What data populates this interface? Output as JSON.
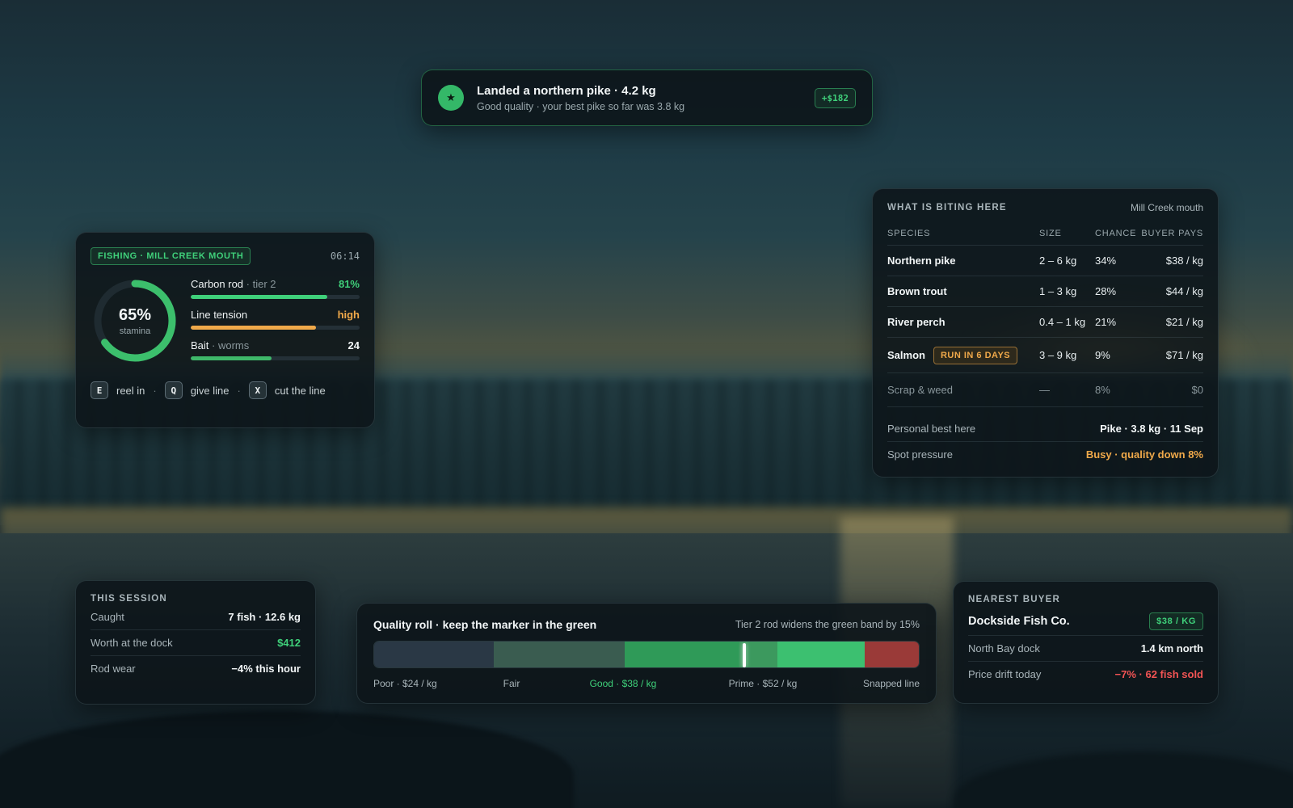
{
  "colors": {
    "accent_green": "#3fd07a",
    "warning_orange": "#f0a94a",
    "danger_red": "#f25454",
    "panel_bg": "#0c1419"
  },
  "toast": {
    "icon": "star-icon",
    "icon_glyph": "★",
    "title": "Landed a northern pike · 4.2 kg",
    "subtitle": "Good quality · your best pike so far was 3.8 kg",
    "reward": "+$182"
  },
  "fishing": {
    "tag": "FISHING · MILL CREEK MOUTH",
    "clock": "06:14",
    "stamina": {
      "percent_label": "65%",
      "label": "stamina",
      "value": 0.65
    },
    "stats": [
      {
        "label": "Carbon rod",
        "sub": " · tier 2",
        "value": "81%",
        "fill": 0.81,
        "color": "#3fd07a"
      },
      {
        "label": "Line tension",
        "sub": "",
        "value": "high",
        "fill": 0.74,
        "color": "#f0a94a"
      },
      {
        "label": "Bait",
        "sub": " · worms",
        "value": "24",
        "fill": 0.48,
        "color": "#3fb86a"
      }
    ],
    "keys": [
      {
        "key": "E",
        "label": "reel in"
      },
      {
        "key": "Q",
        "label": "give line"
      },
      {
        "key": "X",
        "label": "cut the line"
      }
    ],
    "separator": "·"
  },
  "biting": {
    "title": "WHAT IS BITING HERE",
    "location": "Mill Creek mouth",
    "headers": {
      "species": "SPECIES",
      "size": "SIZE",
      "chance": "CHANCE",
      "pay": "BUYER PAYS"
    },
    "rows": [
      {
        "species": "Northern pike",
        "tag": "",
        "size": "2 – 6 kg",
        "chance": "34%",
        "pay": "$38 / kg"
      },
      {
        "species": "Brown trout",
        "tag": "",
        "size": "1 – 3 kg",
        "chance": "28%",
        "pay": "$44 / kg"
      },
      {
        "species": "River perch",
        "tag": "",
        "size": "0.4 – 1 kg",
        "chance": "21%",
        "pay": "$21 / kg"
      },
      {
        "species": "Salmon",
        "tag": "RUN IN 6 DAYS",
        "size": "3 – 9 kg",
        "chance": "9%",
        "pay": "$71 / kg"
      }
    ],
    "scrap": {
      "species": "Scrap & weed",
      "size": "—",
      "chance": "8%",
      "pay": "$0"
    },
    "personal_best": {
      "label": "Personal best here",
      "value": "Pike · 3.8 kg · 11 Sep"
    },
    "pressure": {
      "label": "Spot pressure",
      "value": "Busy · quality down 8%"
    }
  },
  "session": {
    "title": "THIS SESSION",
    "rows": [
      {
        "label": "Caught",
        "value": "7 fish · 12.6 kg",
        "color": "#f2f6f7"
      },
      {
        "label": "Worth at the dock",
        "value": "$412",
        "color": "#3fd07a"
      },
      {
        "label": "Rod wear",
        "value": "−4% this hour",
        "color": "#f2f6f7"
      }
    ]
  },
  "quality": {
    "title": "Quality roll · keep the marker in the green",
    "note": "Tier 2 rod widens the green band by 15%",
    "marker_position": 0.68,
    "green_band": [
      0.67,
      0.74
    ],
    "segments": [
      {
        "name": "Poor",
        "start": 0.0,
        "end": 0.22,
        "color": "#2a3845"
      },
      {
        "name": "Fair",
        "start": 0.22,
        "end": 0.46,
        "color": "#3a5c50"
      },
      {
        "name": "Good",
        "start": 0.46,
        "end": 0.67,
        "color": "#2f9a58"
      },
      {
        "name": "Prime",
        "start": 0.67,
        "end": 0.9,
        "color": "#3cc070"
      },
      {
        "name": "Snapped",
        "start": 0.9,
        "end": 1.0,
        "color": "#9a3a38"
      }
    ],
    "labels": [
      {
        "text": "Poor · $24 / kg",
        "at": 0.0,
        "align": "left",
        "color": "#a9b5ba"
      },
      {
        "text": "Fair",
        "at": 0.253,
        "align": "center",
        "color": "#a9b5ba"
      },
      {
        "text": "Good · $38 / kg",
        "at": 0.457,
        "align": "center",
        "color": "#3fd07a"
      },
      {
        "text": "Prime · $52 / kg",
        "at": 0.713,
        "align": "center",
        "color": "#a9b5ba"
      },
      {
        "text": "Snapped line",
        "at": 1.0,
        "align": "right",
        "color": "#a9b5ba"
      }
    ]
  },
  "buyer": {
    "title": "NEAREST BUYER",
    "name": "Dockside Fish Co.",
    "price": "$38 / KG",
    "rows": [
      {
        "label": "North Bay dock",
        "value": "1.4 km north",
        "color": "#f2f6f7"
      },
      {
        "label": "Price drift today",
        "value": "−7% · 62 fish sold",
        "color": "#f25454"
      }
    ]
  }
}
